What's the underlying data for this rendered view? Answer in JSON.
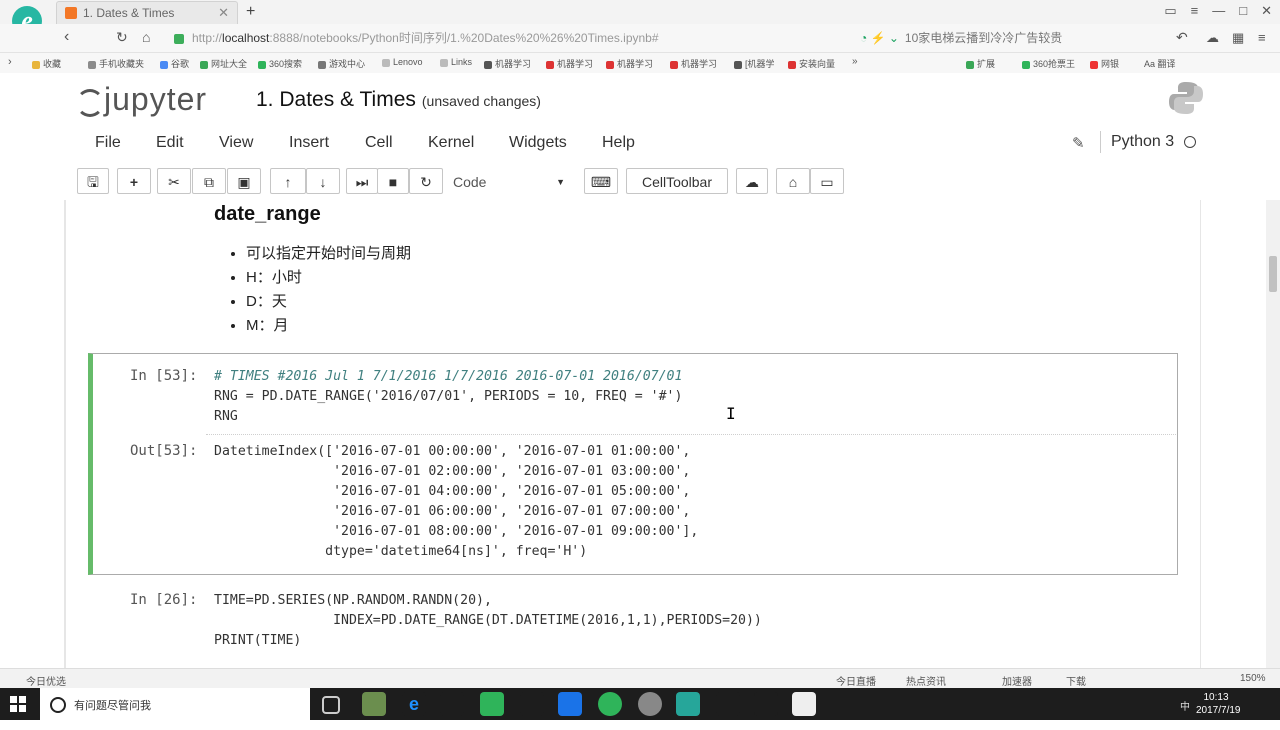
{
  "browser": {
    "tab_title": "1. Dates & Times",
    "url_prefix": "http://",
    "url_host": "localhost",
    "url_path": ":8888/notebooks/Python时间序列/1.%20Dates%20%26%20Times.ipynb#",
    "search_text": "10家电梯云播到冷冷广告较贵",
    "zoom": "150%"
  },
  "bookmarks": [
    "收藏",
    "手机收藏夹",
    "谷歌",
    "网址大全",
    "360搜索",
    "游戏中心",
    "Lenovo",
    "Links",
    "机器学习",
    "机器学习",
    "机器学习",
    "机器学习",
    "[机器学",
    "安装向量",
    "扩展",
    "360抢票王",
    "网银",
    "Aa 翻译"
  ],
  "jupyter": {
    "logo_text": "jupyter",
    "notebook_name": "1. Dates & Times",
    "save_status": "(unsaved changes)",
    "kernel_name": "Python 3"
  },
  "menu": [
    "File",
    "Edit",
    "View",
    "Insert",
    "Cell",
    "Kernel",
    "Widgets",
    "Help"
  ],
  "toolbar": {
    "cell_type": "Code",
    "celltoolbar_label": "CellToolbar"
  },
  "markdown": {
    "heading": "date_range",
    "items": [
      "可以指定开始时间与周期",
      "H：小时",
      "D：天",
      "M：月"
    ]
  },
  "cells": {
    "c53": {
      "in_prompt": "In [53]:",
      "line1": "# TIMES #2016 Jul 1 7/1/2016 1/7/2016 2016-07-01 2016/07/01",
      "line2": "RNG = PD.DATE_RANGE('2016/07/01', PERIODS = 10, FREQ = '#')",
      "line3": "RNG",
      "out_prompt": "Out[53]:",
      "output": "DatetimeIndex(['2016-07-01 00:00:00', '2016-07-01 01:00:00',\n               '2016-07-01 02:00:00', '2016-07-01 03:00:00',\n               '2016-07-01 04:00:00', '2016-07-01 05:00:00',\n               '2016-07-01 06:00:00', '2016-07-01 07:00:00',\n               '2016-07-01 08:00:00', '2016-07-01 09:00:00'],\n              dtype='datetime64[ns]', freq='H')"
    },
    "c26": {
      "in_prompt": "In [26]:",
      "code": "TIME=PD.SERIES(NP.RANDOM.RANDN(20),\n               INDEX=PD.DATE_RANGE(DT.DATETIME(2016,1,1),PERIODS=20))\nPRINT(TIME)"
    }
  },
  "statusbar": {
    "left": "今日优选",
    "items": [
      "今日直播",
      "热点资讯",
      "加速器",
      "下载"
    ],
    "zoom": "150%"
  },
  "taskbar": {
    "search_placeholder": "有问题尽管问我",
    "time": "10:13",
    "date": "2017/7/19",
    "ime": "中"
  }
}
